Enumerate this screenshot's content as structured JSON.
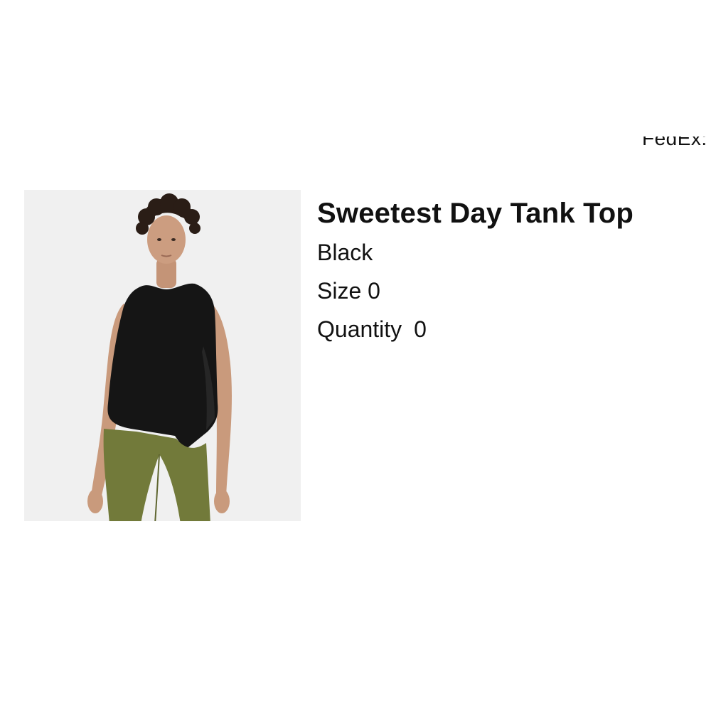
{
  "header": {
    "carrier_link": "FedEx:"
  },
  "product": {
    "image_alt": "Model wearing Sweetest Day Tank Top in Black",
    "title": "Sweetest Day Tank Top",
    "color": "Black",
    "size_label": "Size",
    "size_value": "0",
    "quantity_label": "Quantity",
    "quantity_value": "0"
  },
  "colors": {
    "text": "#111111",
    "background": "#ffffff",
    "image_bg": "#f3f3f3",
    "tank": "#151515",
    "leggings": "#727a3a",
    "skin": "#c99a7c",
    "hair": "#2a1d16"
  }
}
